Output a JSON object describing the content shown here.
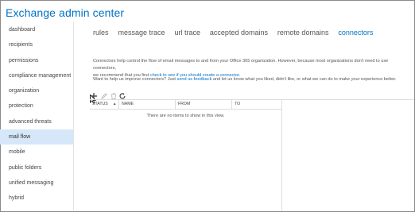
{
  "app": {
    "title": "Exchange admin center"
  },
  "sidebar": {
    "items": [
      {
        "label": "dashboard",
        "active": false
      },
      {
        "label": "recipients",
        "active": false
      },
      {
        "label": "permissions",
        "active": false
      },
      {
        "label": "compliance management",
        "active": false
      },
      {
        "label": "organization",
        "active": false
      },
      {
        "label": "protection",
        "active": false
      },
      {
        "label": "advanced threats",
        "active": false
      },
      {
        "label": "mail flow",
        "active": true
      },
      {
        "label": "mobile",
        "active": false
      },
      {
        "label": "public folders",
        "active": false
      },
      {
        "label": "unified messaging",
        "active": false
      },
      {
        "label": "hybrid",
        "active": false
      }
    ]
  },
  "tabs": [
    {
      "label": "rules",
      "active": false
    },
    {
      "label": "message trace",
      "active": false
    },
    {
      "label": "url trace",
      "active": false
    },
    {
      "label": "accepted domains",
      "active": false
    },
    {
      "label": "remote domains",
      "active": false
    },
    {
      "label": "connectors",
      "active": true
    }
  ],
  "description": {
    "line1": "Connectors help control the flow of email messages to and from your Office 365 organization. However, because most organizations don't need to use connectors,",
    "line2_prefix": "we recommend that you first ",
    "line2_link": "check to see if you should create a connector.",
    "feedback_prefix": "Want to help us improve connectors? Just ",
    "feedback_link": "send us feedback",
    "feedback_suffix": " and let us know what you liked, didn't like, or what we can do to make your experience better."
  },
  "toolbar": {
    "icons": [
      "add-icon",
      "edit-icon",
      "delete-icon",
      "refresh-icon"
    ]
  },
  "grid": {
    "columns": [
      "STATUS",
      "NAME",
      "FROM",
      "TO"
    ],
    "sorted_column": "STATUS",
    "empty_message": "There are no items to show in this view."
  },
  "colors": {
    "accent": "#0072c6",
    "active_nav_bg": "#d5e7f8"
  }
}
